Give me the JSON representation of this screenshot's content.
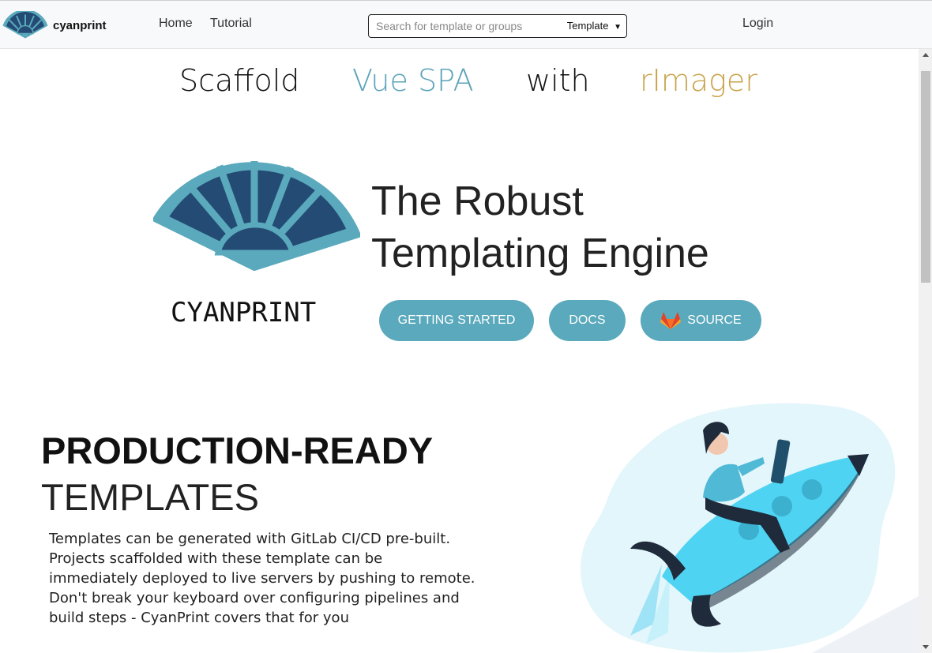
{
  "header": {
    "brand": "cyanprint",
    "nav": [
      {
        "label": "Home"
      },
      {
        "label": "Tutorial"
      }
    ],
    "search": {
      "placeholder": "Search for template or groups",
      "scope": "Template"
    },
    "login": "Login"
  },
  "banner": {
    "words": [
      "Scaffold",
      "Vue SPA",
      "with",
      "rImager"
    ],
    "colors": [
      "#111111",
      "#5ba3b8",
      "#111111",
      "#c9a24a"
    ]
  },
  "hero": {
    "wordmark": "CYANPRINT",
    "title_line1": "The Robust",
    "title_line2": "Templating Engine",
    "buttons": {
      "getting_started": "GETTING STARTED",
      "docs": "DOCS",
      "source": "SOURCE"
    },
    "source_icon": "gitlab-icon"
  },
  "feature": {
    "title_bold": "PRODUCTION-READY",
    "title_light": "TEMPLATES",
    "description": "Templates can be generated with GitLab CI/CD pre-built. Projects scaffolded with these template can be immediately deployed to live servers by pushing to remote. Don't break your keyboard over configuring pipelines and build steps - CyanPrint covers that for you",
    "illustration": "rocket-rider-illustration"
  },
  "colors": {
    "accent": "#5aa9bc",
    "fan_dark": "#244b73",
    "fan_light": "#5aa9bc"
  }
}
